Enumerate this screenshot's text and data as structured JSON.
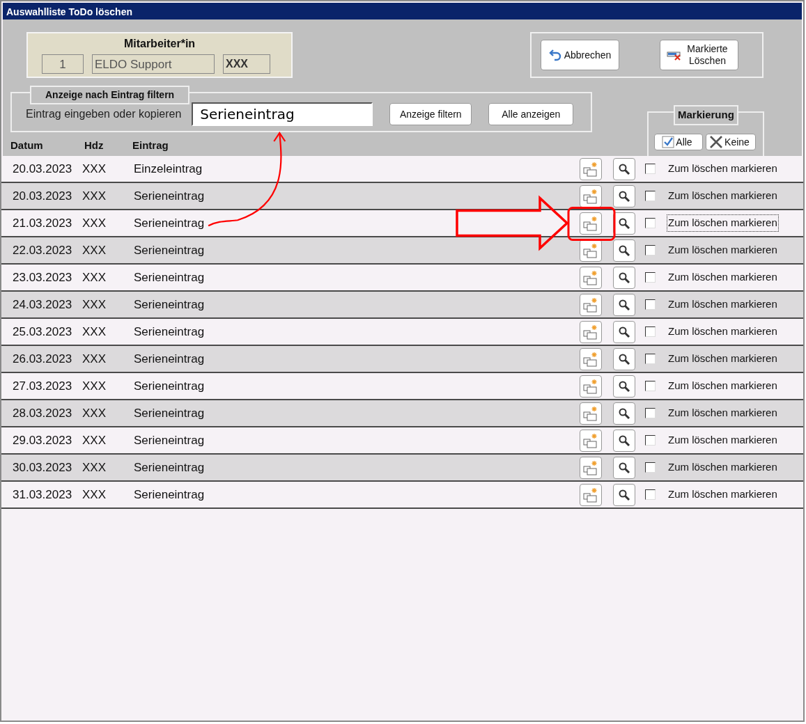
{
  "window": {
    "title": "Auswahlliste ToDo löschen"
  },
  "employee": {
    "title": "Mitarbeiter*in",
    "number": "1",
    "name": "ELDO Support",
    "code": "XXX"
  },
  "actions": [
    {
      "label": "Abbrechen",
      "kind": "cancel"
    },
    {
      "label": "Markierte Löschen",
      "kind": "delete"
    }
  ],
  "filter": {
    "title": "Anzeige nach Eintrag filtern",
    "label": "Eintrag eingeben oder kopieren",
    "value": "Serieneintrag",
    "buttons": [
      "Anzeige filtern",
      "Alle anzeigen"
    ]
  },
  "marking": {
    "title": "Markierung",
    "buttons": [
      {
        "label": "Alle",
        "kind": "check"
      },
      {
        "label": "Keine",
        "kind": "cross"
      }
    ]
  },
  "table": {
    "columns": [
      "Datum",
      "Hdz",
      "Eintrag"
    ],
    "rows": [
      {
        "date": "20.03.2023",
        "hdz": "XXX",
        "entry": "Einzeleintrag",
        "mark_label": "Zum löschen markieren",
        "checked": false,
        "focused": false,
        "highlighted": false,
        "linked_to_filter": false
      },
      {
        "date": "20.03.2023",
        "hdz": "XXX",
        "entry": "Serieneintrag",
        "mark_label": "Zum löschen markieren",
        "checked": false,
        "focused": false,
        "highlighted": false,
        "linked_to_filter": false
      },
      {
        "date": "21.03.2023",
        "hdz": "XXX",
        "entry": "Serieneintrag",
        "mark_label": "Zum löschen markieren",
        "checked": false,
        "focused": true,
        "highlighted": true,
        "linked_to_filter": true
      },
      {
        "date": "22.03.2023",
        "hdz": "XXX",
        "entry": "Serieneintrag",
        "mark_label": "Zum löschen markieren",
        "checked": false,
        "focused": false,
        "highlighted": false,
        "linked_to_filter": false
      },
      {
        "date": "23.03.2023",
        "hdz": "XXX",
        "entry": "Serieneintrag",
        "mark_label": "Zum löschen markieren",
        "checked": false,
        "focused": false,
        "highlighted": false,
        "linked_to_filter": false
      },
      {
        "date": "24.03.2023",
        "hdz": "XXX",
        "entry": "Serieneintrag",
        "mark_label": "Zum löschen markieren",
        "checked": false,
        "focused": false,
        "highlighted": false,
        "linked_to_filter": false
      },
      {
        "date": "25.03.2023",
        "hdz": "XXX",
        "entry": "Serieneintrag",
        "mark_label": "Zum löschen markieren",
        "checked": false,
        "focused": false,
        "highlighted": false,
        "linked_to_filter": false
      },
      {
        "date": "26.03.2023",
        "hdz": "XXX",
        "entry": "Serieneintrag",
        "mark_label": "Zum löschen markieren",
        "checked": false,
        "focused": false,
        "highlighted": false,
        "linked_to_filter": false
      },
      {
        "date": "27.03.2023",
        "hdz": "XXX",
        "entry": "Serieneintrag",
        "mark_label": "Zum löschen markieren",
        "checked": false,
        "focused": false,
        "highlighted": false,
        "linked_to_filter": false
      },
      {
        "date": "28.03.2023",
        "hdz": "XXX",
        "entry": "Serieneintrag",
        "mark_label": "Zum löschen markieren",
        "checked": false,
        "focused": false,
        "highlighted": false,
        "linked_to_filter": false
      },
      {
        "date": "29.03.2023",
        "hdz": "XXX",
        "entry": "Serieneintrag",
        "mark_label": "Zum löschen markieren",
        "checked": false,
        "focused": false,
        "highlighted": false,
        "linked_to_filter": false
      },
      {
        "date": "30.03.2023",
        "hdz": "XXX",
        "entry": "Serieneintrag",
        "mark_label": "Zum löschen markieren",
        "checked": false,
        "focused": false,
        "highlighted": false,
        "linked_to_filter": false
      },
      {
        "date": "31.03.2023",
        "hdz": "XXX",
        "entry": "Serieneintrag",
        "mark_label": "Zum löschen markieren",
        "checked": false,
        "focused": false,
        "highlighted": false,
        "linked_to_filter": false
      }
    ]
  }
}
